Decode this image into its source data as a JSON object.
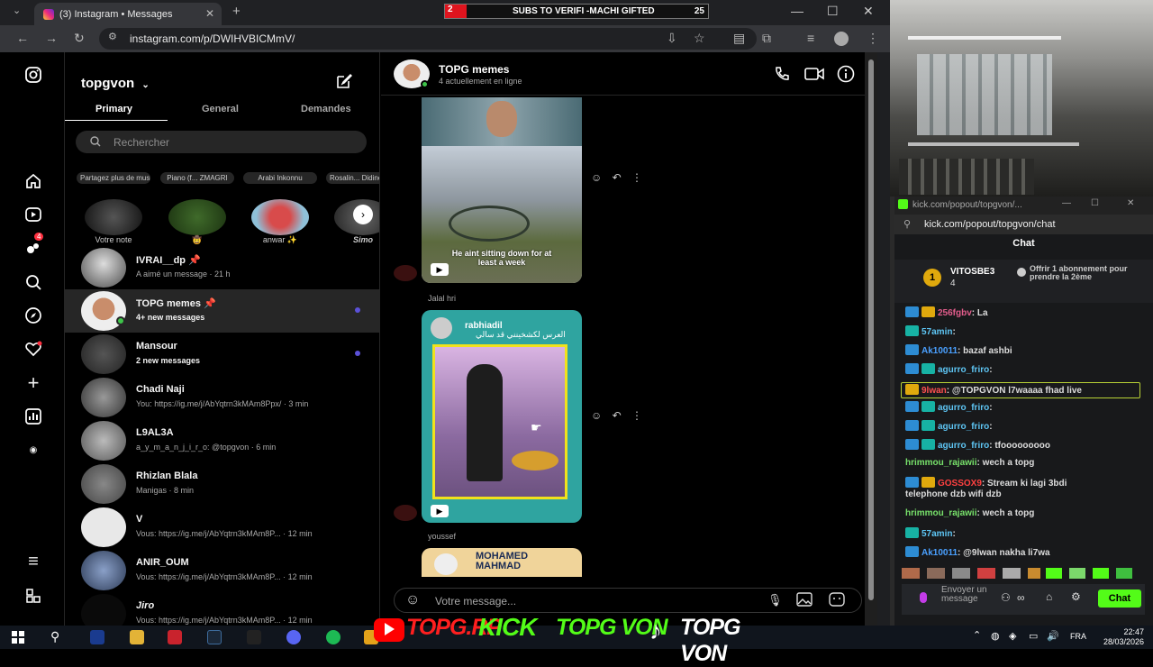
{
  "browser": {
    "tab_title": "(3) Instagram • Messages",
    "url": "instagram.com/p/DWIHVBICMmV/",
    "banner": {
      "left_num": "2",
      "text": "SUBS TO VERIFI -MACHI GIFTED",
      "right_num": "25"
    }
  },
  "sidebar": {
    "account": "topgvon",
    "tabs": [
      "Primary",
      "General",
      "Demandes"
    ],
    "search_placeholder": "Rechercher",
    "notes": [
      {
        "bubble": "Partagez plus de musique...",
        "name": "Votre note"
      },
      {
        "bubble": "Piano (f... ZMAGRI",
        "name": "🤠"
      },
      {
        "bubble": "Arabi Inkonnu",
        "name": "anwar ✨"
      },
      {
        "bubble": "Rosalin... Didine Cano",
        "name": "Simo"
      }
    ],
    "notif_count": "4",
    "threads": [
      {
        "name": "IVRAI__dp 📌",
        "sub": "A aimé un message · 21 h",
        "unread": false
      },
      {
        "name": "TOPG memes 📌",
        "sub": "4+ new messages",
        "unread": true
      },
      {
        "name": "Mansour",
        "sub": "2 new messages",
        "unread": true
      },
      {
        "name": "Chadi Naji",
        "sub": "You: https://ig.me/j/AbYqtrn3kMAm8Ppx/ · 3 min",
        "unread": false
      },
      {
        "name": "L9AL3A",
        "sub": "a_y_m_a_n_j_i_r_o: @topgvon · 6 min",
        "unread": false
      },
      {
        "name": "Rhizlan Blala",
        "sub": "Manigas · 8 min",
        "unread": false
      },
      {
        "name": "V",
        "sub": "Vous: https://ig.me/j/AbYqtrn3kMAm8P... · 12 min",
        "unread": false
      },
      {
        "name": "ANIR_OUM",
        "sub": "Vous: https://ig.me/j/AbYqtrn3kMAm8P... · 12 min",
        "unread": false
      },
      {
        "name": "Jiro",
        "sub": "Vous: https://ig.me/j/AbYqtrn3kMAm8P... · 12 min",
        "unread": false
      }
    ]
  },
  "conversation": {
    "title": "TOPG memes",
    "subtitle": "4 actuellement en ligne",
    "msg1_caption": "He aint sitting down for at least a week",
    "sender2": "Jalal hri",
    "msg2_header": "rabhiadil",
    "msg2_arabic": "العرس لكشخينني قد سالي",
    "sender3": "youssef",
    "msg3_caption": "MOHAMED MAHMAD",
    "input_placeholder": "Votre message..."
  },
  "kick": {
    "window_title": "kick.com/popout/topgvon/...",
    "url": "kick.com/popout/topgvon/chat",
    "chat_title": "Chat",
    "top_gifter": {
      "rank": "1",
      "name": "VITOSBE3",
      "count": "4"
    },
    "sub_prompt": "Offrir 1 abonnement pour prendre la 2ème",
    "messages": [
      {
        "user": "256fgbv",
        "text": ": La",
        "color": "#e35d8c"
      },
      {
        "user": "57amin",
        "text": ":",
        "color": "#5ec6f5"
      },
      {
        "user": "Ak10011",
        "text": ": bazaf ashbi",
        "color": "#4aa0ff"
      },
      {
        "user": "agurro_friro",
        "text": ":",
        "color": "#5ec6f5"
      },
      {
        "user": "9lwan",
        "text": ": @TOPGVON l7waaaa fhad live",
        "color": "#ff5050"
      },
      {
        "user": "agurro_friro",
        "text": ":",
        "color": "#5ec6f5"
      },
      {
        "user": "agurro_friro",
        "text": ":",
        "color": "#5ec6f5"
      },
      {
        "user": "agurro_friro",
        "text": ": tfooooooooo",
        "color": "#5ec6f5"
      },
      {
        "user": "hrimmou_rajawii",
        "text": ": wech a topg",
        "color": "#78e26b"
      },
      {
        "user": "GOSSOX9",
        "text": ": Stream ki lagi 3bdi",
        "color": "#ff4040"
      },
      {
        "user": "",
        "text": "telephone dzb wifi dzb",
        "color": "#ddd"
      },
      {
        "user": "hrimmou_rajawii",
        "text": ": wech a topg",
        "color": "#78e26b"
      },
      {
        "user": "57amin",
        "text": ":",
        "color": "#5ec6f5"
      },
      {
        "user": "Ak10011",
        "text": ": @9lwan nakha li7wa",
        "color": "#4aa0ff"
      }
    ],
    "send_label": "Envoyer un message",
    "chat_button": "Chat"
  },
  "overlay": {
    "yt": "TOPG.RP",
    "kick": "KICK",
    "kick_name": "TOPG VON",
    "tiktok": "TOPG VON"
  },
  "taskbar": {
    "lang": "FRA",
    "time": "22:47",
    "date": "28/03/2026"
  }
}
